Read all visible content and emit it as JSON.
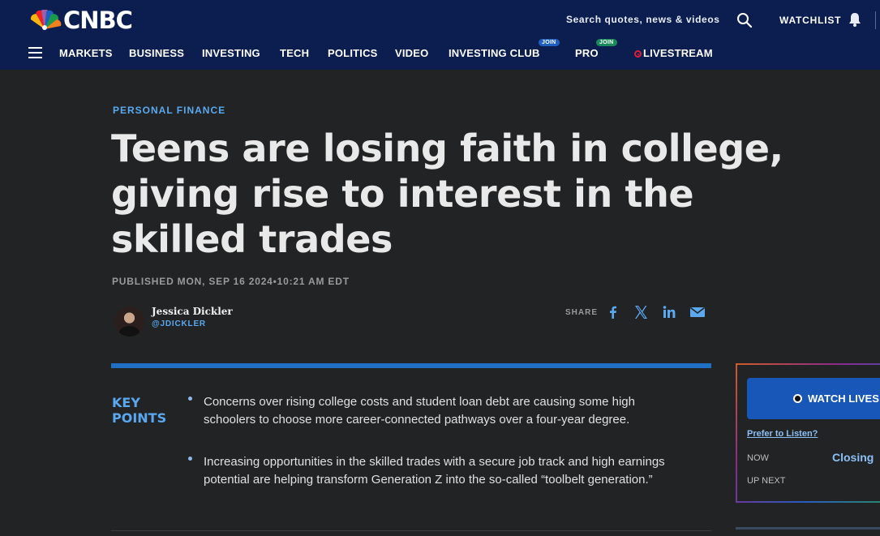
{
  "header": {
    "logo_text": "CNBC",
    "search_placeholder": "Search quotes, news & videos",
    "watchlist_label": "WATCHLIST",
    "nav": [
      {
        "label": "MARKETS"
      },
      {
        "label": "BUSINESS"
      },
      {
        "label": "INVESTING"
      },
      {
        "label": "TECH"
      },
      {
        "label": "POLITICS"
      },
      {
        "label": "VIDEO"
      },
      {
        "label": "INVESTING CLUB",
        "badge": "JOIN"
      },
      {
        "label": "PRO",
        "badge": "JOIN"
      },
      {
        "label": "LIVESTREAM"
      }
    ]
  },
  "article": {
    "category": "PERSONAL FINANCE",
    "headline": "Teens are losing faith in college, giving rise to interest in the skilled trades",
    "published": "PUBLISHED MON, SEP 16 2024•10:21 AM EDT",
    "author": {
      "name": "Jessica Dickler",
      "handle": "@JDICKLER"
    },
    "share_label": "SHARE",
    "share_icons": [
      "facebook-icon",
      "x-icon",
      "linkedin-icon",
      "email-icon"
    ],
    "key_points_title": "KEY POINTS",
    "key_points": [
      "Concerns over rising college costs and student loan debt are causing some high schoolers to choose more career-connected pathways over a four-year degree.",
      "Increasing opportunities in the skilled trades with a secure job track and high earnings potential are helping transform Generation Z into the so-called “toolbelt generation.”"
    ]
  },
  "widget": {
    "watch_label": "WATCH LIVES",
    "prefer_label": "Prefer to Listen?",
    "now_label": "NOW",
    "now_title": "Closing",
    "upnext_label": "UP NEXT"
  },
  "colors": {
    "header_bg": "#0b1e4f",
    "page_bg": "#222324",
    "accent_blue": "#5aa9f0",
    "bar_blue": "#1f6fc5",
    "live_red": "#e0203a",
    "join_club": "#1f5fbf",
    "join_pro": "#1a8a5a"
  }
}
